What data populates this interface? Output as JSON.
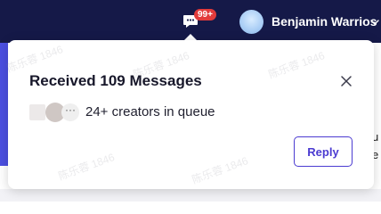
{
  "header": {
    "username": "Benjamin Warrios",
    "notification_badge": "99+"
  },
  "popover": {
    "title": "Received 109 Messages",
    "queue_text": "24+ creators in queue",
    "more_indicator": "···",
    "reply_label": "Reply"
  },
  "background": {
    "right_text_1": "n",
    "right_text_2": "u",
    "right_text_3": "e"
  },
  "watermark": {
    "text": "陈乐蓉 1846"
  },
  "colors": {
    "topbar": "#151948",
    "accent": "#4b3bd1",
    "badge": "#e23b3b"
  },
  "icons": {
    "message": "chat-bubble-icon",
    "close": "close-icon",
    "user_menu": "chevron-down-icon"
  }
}
